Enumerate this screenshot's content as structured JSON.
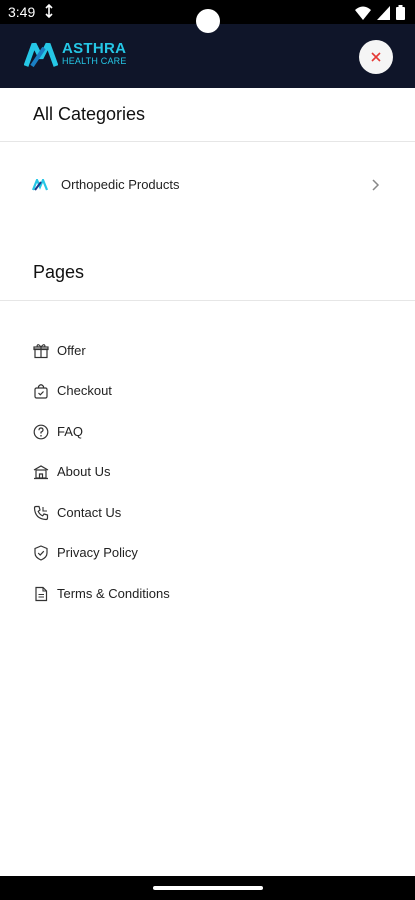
{
  "status_bar": {
    "time": "3:49"
  },
  "header": {
    "logo_line1": "ASTHRA",
    "logo_line2": "HEALTH CARE",
    "close_icon": "close-icon"
  },
  "categories": {
    "title": "All Categories",
    "items": [
      {
        "label": "Orthopedic Products",
        "icon": "brand-icon"
      }
    ]
  },
  "pages": {
    "title": "Pages",
    "items": [
      {
        "label": "Offer",
        "icon": "gift-icon"
      },
      {
        "label": "Checkout",
        "icon": "bag-icon"
      },
      {
        "label": "FAQ",
        "icon": "help-icon"
      },
      {
        "label": "About Us",
        "icon": "building-icon"
      },
      {
        "label": "Contact Us",
        "icon": "phone-icon"
      },
      {
        "label": "Privacy Policy",
        "icon": "shield-icon"
      },
      {
        "label": "Terms & Conditions",
        "icon": "document-icon"
      }
    ]
  },
  "colors": {
    "header_bg": "#0f1529",
    "brand_accent": "#25c7e6",
    "close_x": "#e53935"
  }
}
